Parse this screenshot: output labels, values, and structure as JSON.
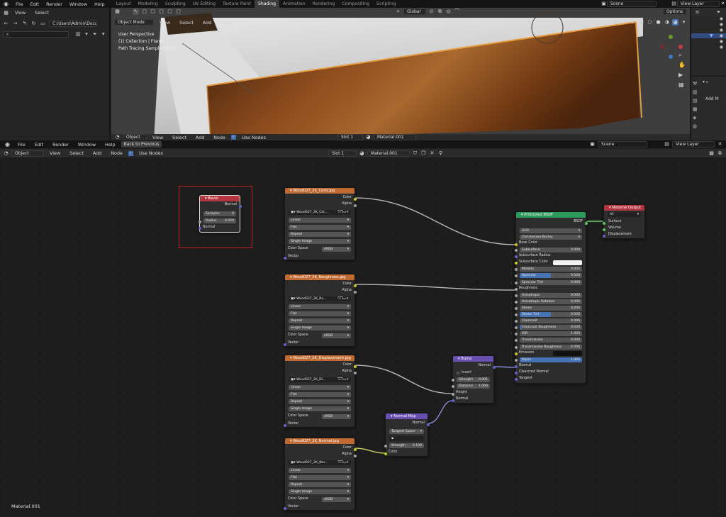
{
  "topbar": {
    "menus": [
      "File",
      "Edit",
      "Render",
      "Window",
      "Help"
    ],
    "workspaces": [
      "Layout",
      "Modeling",
      "Sculpting",
      "UV Editing",
      "Texture Paint",
      "Shading",
      "Animation",
      "Rendering",
      "Compositing",
      "Scripting"
    ],
    "active_workspace": "Shading",
    "scene": "Scene",
    "view_layer": "View Layer"
  },
  "file_browser": {
    "menus": [
      "View",
      "Select"
    ],
    "path": "C:\\Users\\Admin\\Docu..."
  },
  "viewport": {
    "mode": "Object Mode",
    "menus": [
      "View",
      "Select",
      "Add",
      "Object"
    ],
    "orientation": "Global",
    "options_label": "Options",
    "overlay_lines": [
      "User Perspective",
      "(1) Collection | Flanks",
      "Path Tracing Sample 13/32"
    ],
    "footer": {
      "mode": "Object",
      "menus": [
        "View",
        "Select",
        "Add",
        "Node"
      ],
      "use_nodes": "Use Nodes",
      "slot": "Slot 1",
      "material": "Material.001"
    }
  },
  "properties": {
    "add_label": "Add M"
  },
  "image_editor_bar": {
    "menus": [
      "File",
      "Edit",
      "Render",
      "Window",
      "Help"
    ],
    "back_label": "Back to Previous",
    "scene": "Scene",
    "view_layer": "View Layer"
  },
  "node_header": {
    "mode": "Object",
    "menus": [
      "View",
      "Select",
      "Add",
      "Node"
    ],
    "use_nodes": "Use Nodes",
    "slot": "Slot 1",
    "material": "Material.001"
  },
  "material_label": "Material.001",
  "nodes": {
    "bevel": {
      "title": "Bevel",
      "out_normal": "Normal",
      "samples_label": "Samples",
      "samples": "4",
      "radius_label": "Radius",
      "radius": "0.050",
      "in_normal": "Normal"
    },
    "tex_color": {
      "title": "Wood027_2K_Color.jpg",
      "image": "Wood027_2K_Col..."
    },
    "tex_rough": {
      "title": "Wood027_2K_Roughness.jpg",
      "image": "Wood027_2K_Ro..."
    },
    "tex_disp": {
      "title": "Wood027_2K_Displacement.jpg",
      "image": "Wood027_2K_Di..."
    },
    "tex_normal": {
      "title": "Wood027_2K_Normal.jpg",
      "image": "Wood027_2K_Nor..."
    },
    "tex_common": {
      "out_color": "Color",
      "out_alpha": "Alpha",
      "interp": "Linear",
      "proj": "Flat",
      "ext": "Repeat",
      "source": "Single Image",
      "cs_label": "Color Space",
      "cs_value": "sRGB",
      "vector": "Vector"
    },
    "bump": {
      "title": "Bump",
      "out_normal": "Normal",
      "invert": "Invert",
      "strength_label": "Strength",
      "strength": "0.001",
      "distance_label": "Distance",
      "distance": "1.000",
      "height": "Height",
      "normal": "Normal"
    },
    "normal_map": {
      "title": "Normal Map",
      "out_normal": "Normal",
      "space": "Tangent Space",
      "strength_label": "Strength",
      "strength": "0.100",
      "color": "Color"
    },
    "bsdf": {
      "title": "Principled BSDF",
      "out_bsdf": "BSDF",
      "dist": "GGX",
      "sss_method": "Christensen-Burley",
      "base_color": "Base Color",
      "params": [
        {
          "label": "Subsurface",
          "value": "0.000",
          "fill": 0
        },
        {
          "label": "Subsurface Radius",
          "value": "",
          "fill": 0,
          "kind": "plain"
        },
        {
          "label": "Subsurface Color",
          "value": "",
          "fill": 0,
          "kind": "color"
        },
        {
          "label": "Metallic",
          "value": "0.000",
          "fill": 0
        },
        {
          "label": "Specular",
          "value": "0.500",
          "fill": 0.5
        },
        {
          "label": "Specular Tint",
          "value": "0.000",
          "fill": 0
        },
        {
          "label": "Roughness",
          "value": "",
          "fill": 0,
          "kind": "plain"
        },
        {
          "label": "Anisotropic",
          "value": "0.000",
          "fill": 0
        },
        {
          "label": "Anisotropic Rotation",
          "value": "0.000",
          "fill": 0
        },
        {
          "label": "Sheen",
          "value": "0.000",
          "fill": 0
        },
        {
          "label": "Sheen Tint",
          "value": "0.500",
          "fill": 0.5
        },
        {
          "label": "Clearcoat",
          "value": "0.000",
          "fill": 0
        },
        {
          "label": "Clearcoat Roughness",
          "value": "0.030",
          "fill": 0.03
        },
        {
          "label": "IOR",
          "value": "1.450",
          "fill": 0
        },
        {
          "label": "Transmission",
          "value": "0.000",
          "fill": 0
        },
        {
          "label": "Transmission Roughness",
          "value": "0.000",
          "fill": 0
        },
        {
          "label": "Emission",
          "value": "",
          "fill": 0,
          "kind": "dark"
        },
        {
          "label": "Alpha",
          "value": "1.000",
          "fill": 1
        }
      ],
      "tail": [
        "Normal",
        "Clearcoat Normal",
        "Tangent"
      ]
    },
    "output": {
      "title": "Material Output",
      "target": "All",
      "surface": "Surface",
      "volume": "Volume",
      "displacement": "Displacement"
    }
  },
  "colors": {
    "texture_header": "#c06a32",
    "bsdf_header": "#2a9b5a",
    "output_header": "#b3353f",
    "vector_header": "#6a4fb3",
    "select_accent": "#4772b3"
  }
}
